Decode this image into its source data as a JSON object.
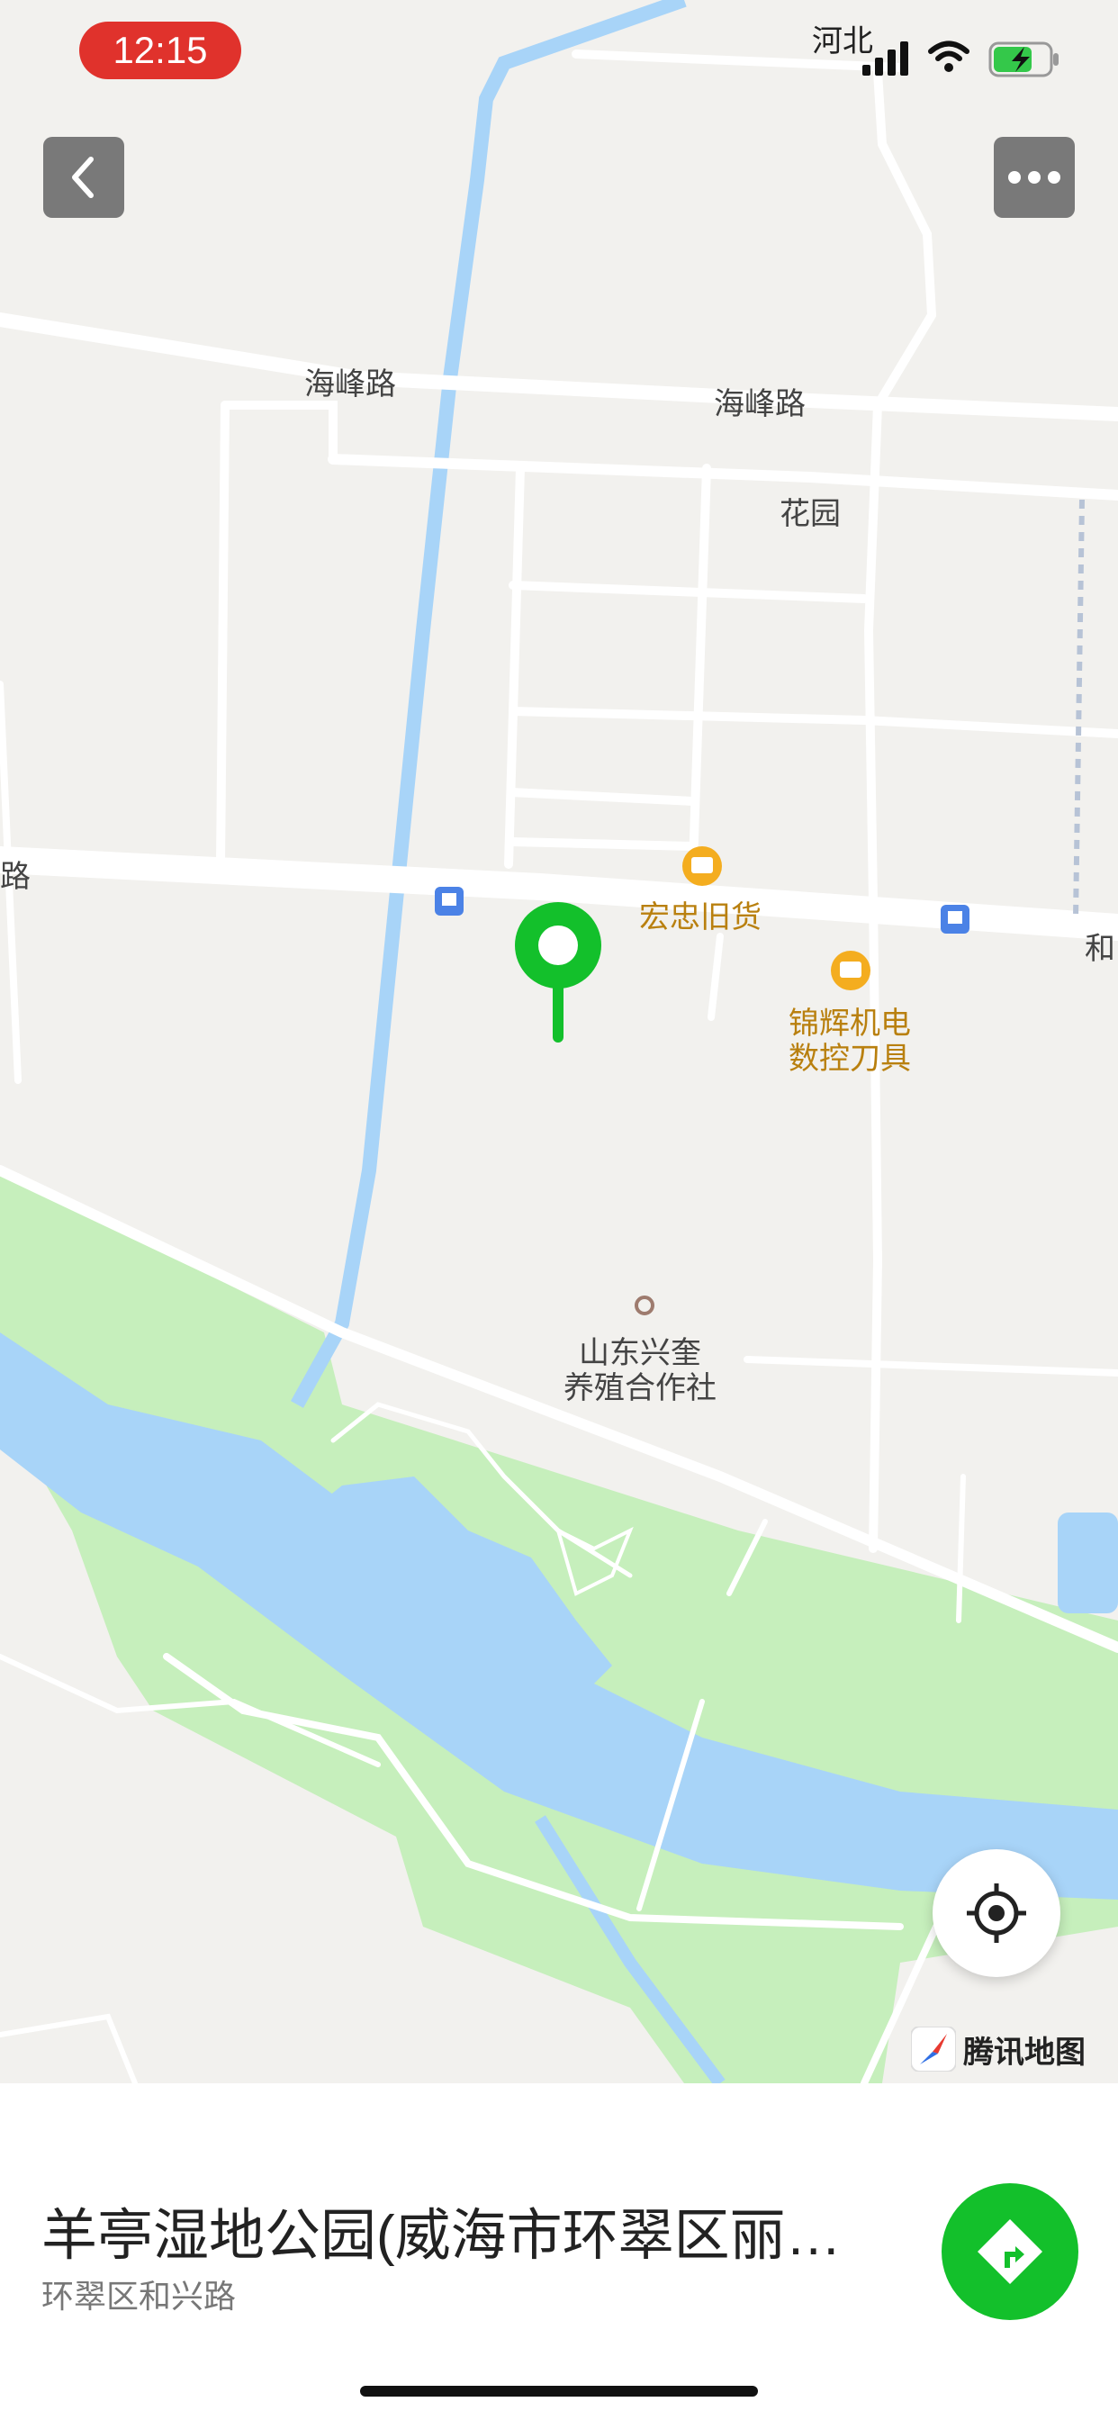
{
  "status_bar": {
    "time": "12:15",
    "carrier": "河北",
    "time_pill_color": "#e0322c"
  },
  "top_bar": {
    "back_icon": "chevron-left-icon",
    "more_icon": "more-dots-icon"
  },
  "map": {
    "road_labels": {
      "haifeng_left": "海峰路",
      "haifeng_right": "海峰路",
      "left_edge": "路",
      "right_edge": "和"
    },
    "area_labels": {
      "garden": "花园"
    },
    "pois": {
      "hongzhong": "宏忠旧货",
      "jinhui_line1": "锦辉机电",
      "jinhui_line2": "数控刀具",
      "shandong_line1": "山东兴奎",
      "shandong_line2": "养殖合作社"
    },
    "pin_color": "#13c02b",
    "water_color": "#a8d4f8",
    "park_color": "#c6efbc",
    "poi_color": "#f4ad1f"
  },
  "locate_button": {
    "icon": "crosshair-icon"
  },
  "logo": {
    "text": "腾讯地图"
  },
  "place": {
    "title": "羊亭湿地公园(威海市环翠区丽…",
    "subtitle": "环翠区和兴路"
  },
  "navigate_button": {
    "icon": "navigate-arrow-icon",
    "color": "#13c02b"
  }
}
